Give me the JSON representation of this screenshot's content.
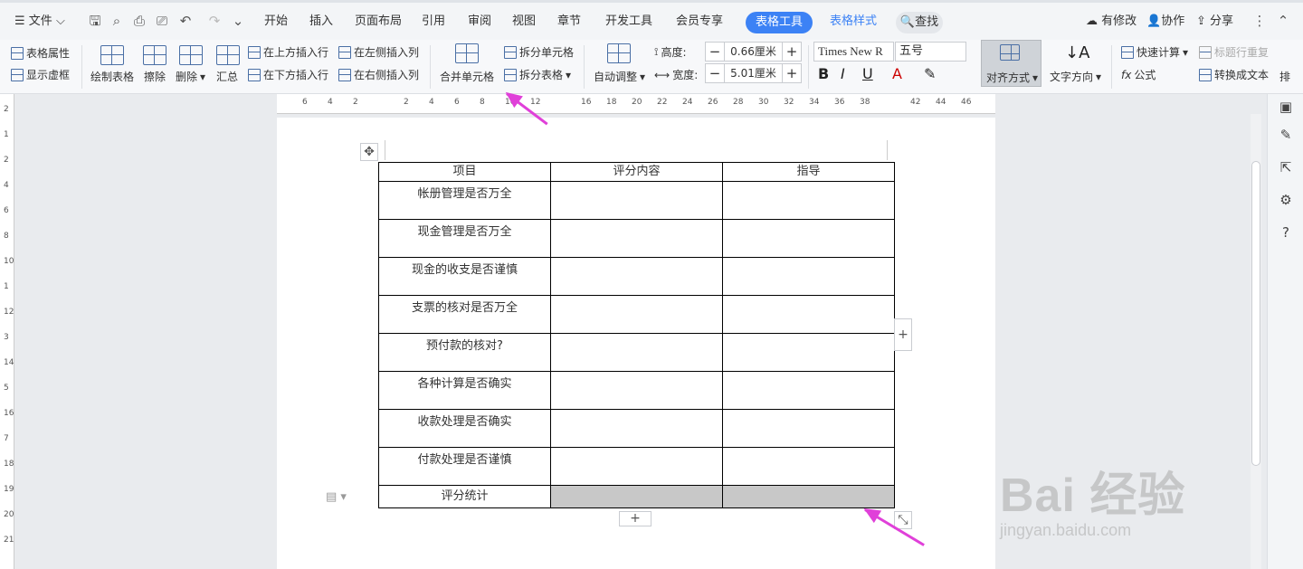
{
  "menu": {
    "file": "文件"
  },
  "tabs": [
    "开始",
    "插入",
    "页面布局",
    "引用",
    "审阅",
    "视图",
    "章节",
    "开发工具",
    "会员专享"
  ],
  "active_tab": "表格工具",
  "style_tab": "表格样式",
  "search": "查找",
  "right_actions": [
    "有修改",
    "协作",
    "分享"
  ],
  "ribbon": {
    "table_props": "表格属性",
    "show_grid": "显示虚框",
    "draw_table": "绘制表格",
    "erase": "擦除",
    "delete": "删除",
    "summary": "汇总",
    "insert_above": "在上方插入行",
    "insert_below": "在下方插入行",
    "insert_left": "在左侧插入列",
    "insert_right": "在右侧插入列",
    "merge_cells": "合并单元格",
    "split_cells": "拆分单元格",
    "split_table": "拆分表格",
    "auto_fit": "自动调整",
    "height_label": "高度:",
    "height_value": "0.66厘米",
    "width_label": "宽度:",
    "width_value": "5.01厘米",
    "font_name": "Times New R",
    "font_size": "五号",
    "align": "对齐方式",
    "text_dir": "文字方向",
    "quick_calc": "快速计算",
    "header_repeat": "标题行重复",
    "formula": "公式",
    "to_text": "转换成文本",
    "more": "排"
  },
  "ruler_numbers": [
    "6",
    "4",
    "2",
    "2",
    "4",
    "6",
    "8",
    "10",
    "12",
    "16",
    "18",
    "20",
    "22",
    "24",
    "26",
    "28",
    "30",
    "32",
    "34",
    "36",
    "38",
    "42",
    "44",
    "46"
  ],
  "vruler_numbers": [
    "2",
    "1",
    "2",
    "4",
    "6",
    "8",
    "10",
    "1",
    "12",
    "3",
    "14",
    "5",
    "16",
    "7",
    "18",
    "19",
    "20",
    "21"
  ],
  "table": {
    "headers": [
      "项目",
      "评分内容",
      "指导"
    ],
    "rows": [
      "帐册管理是否万全",
      "现金管理是否万全",
      "现金的收支是否谨慎",
      "支票的核对是否万全",
      "预付款的核对?",
      "各种计算是否确实",
      "收款处理是否确实",
      "付款处理是否谨慎"
    ],
    "last_row": "评分统计"
  },
  "watermark": {
    "brand": "Bai  经验",
    "url": "jingyan.baidu.com"
  },
  "colors": {
    "accent": "#3c82f5",
    "arrow": "#e040d9",
    "gray_cell": "#c8c8c8"
  }
}
